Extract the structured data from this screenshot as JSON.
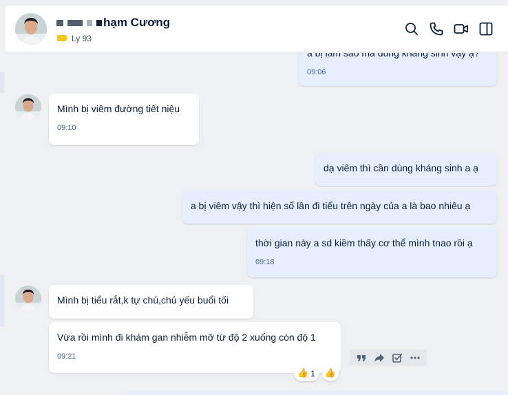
{
  "header": {
    "contact_name": "hạm Cương",
    "tag_label": "Ly 93",
    "tag_color": "#f5c518",
    "icons": [
      "search-icon",
      "phone-icon",
      "video-call-icon",
      "sidebar-toggle-icon"
    ]
  },
  "messages": [
    {
      "direction": "outgoing",
      "text": "a bị làm sao mà dùng kháng sinh vậy ạ?",
      "time": "09:06"
    },
    {
      "direction": "incoming",
      "text": "Mình bị viêm đường tiết niệu",
      "time": "09:10"
    },
    {
      "direction": "outgoing",
      "text": "dạ viêm thì cần dùng kháng sinh a ạ",
      "time": ""
    },
    {
      "direction": "outgoing",
      "text": "a bị viêm vậy thì hiện số lần đi tiểu trên ngày của a là bao nhiêu ạ",
      "time": ""
    },
    {
      "direction": "outgoing",
      "text": "thời gian này a sd kiềm thấy cơ thể mình tnao rồi ạ",
      "time": "09:18"
    },
    {
      "direction": "incoming",
      "text": "Mình bị tiểu rắt,k tự chủ,chủ yếu buổi tối",
      "time": ""
    },
    {
      "direction": "incoming",
      "text": "Vừa rồi mình đi khám gan nhiễm mỡ từ độ 2 xuống còn độ 1",
      "time": "09:21"
    }
  ],
  "reactions": {
    "thumbs_count": "1",
    "thumb_glyph": "👍"
  },
  "message_actions": [
    "quote-icon",
    "forward-icon",
    "task-icon",
    "more-icon"
  ],
  "colors": {
    "incoming_bg": "#ffffff",
    "outgoing_bg": "#e5efff",
    "background": "#eef0f1"
  }
}
